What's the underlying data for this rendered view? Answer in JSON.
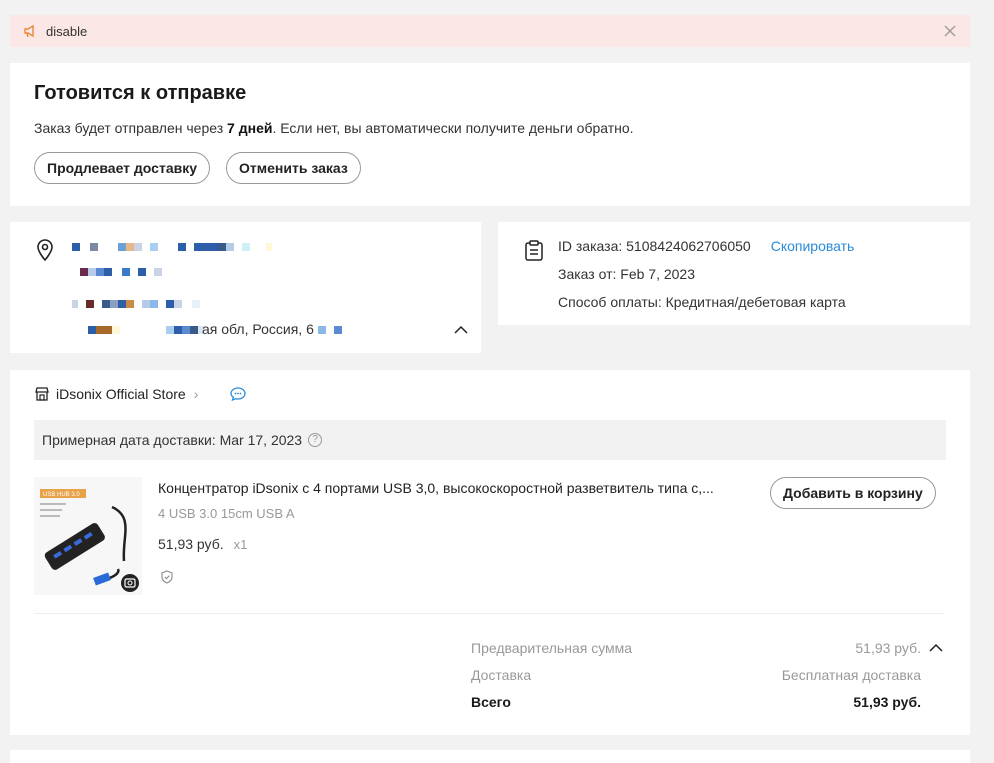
{
  "banner": {
    "text": "disable",
    "icon": "megaphone-icon"
  },
  "status": {
    "title": "Готовится к отправке",
    "desc_before": "Заказ будет отправлен через ",
    "desc_bold": "7 дней",
    "desc_after": ". Если нет, вы автоматически получите деньги обратно.",
    "extend_label": "Продлевает доставку",
    "cancel_label": "Отменить заказ"
  },
  "address": {
    "visible_fragment": "ая обл, Россия, 6"
  },
  "order_info": {
    "id_label": "ID заказа: 5108424062706050",
    "copy_label": "Скопировать",
    "date_label": "Заказ от: Feb 7, 2023",
    "payment_label": "Способ оплаты: Кредитная/дебетовая карта"
  },
  "store": {
    "name": "iDsonix Official Store",
    "delivery_estimate": "Примерная дата доставки: Mar 17, 2023"
  },
  "product": {
    "title": "Концентратор iDsonix с 4 портами USB 3,0, высокоскоростной разветвитель типа с,...",
    "variant": "4 USB 3.0 15cm USB A",
    "price": "51,93 руб.",
    "qty": "x1",
    "add_to_cart_label": "Добавить в корзину",
    "image_caption": "USB HUB 3.0"
  },
  "summary": {
    "subtotal_label": "Предварительная сумма",
    "subtotal_value": "51,93 руб.",
    "shipping_label": "Доставка",
    "shipping_value": "Бесплатная доставка",
    "total_label": "Всего",
    "total_value": "51,93 руб."
  },
  "colors": {
    "accent_link": "#2a8bd8",
    "banner_bg": "#fbe7e5"
  }
}
